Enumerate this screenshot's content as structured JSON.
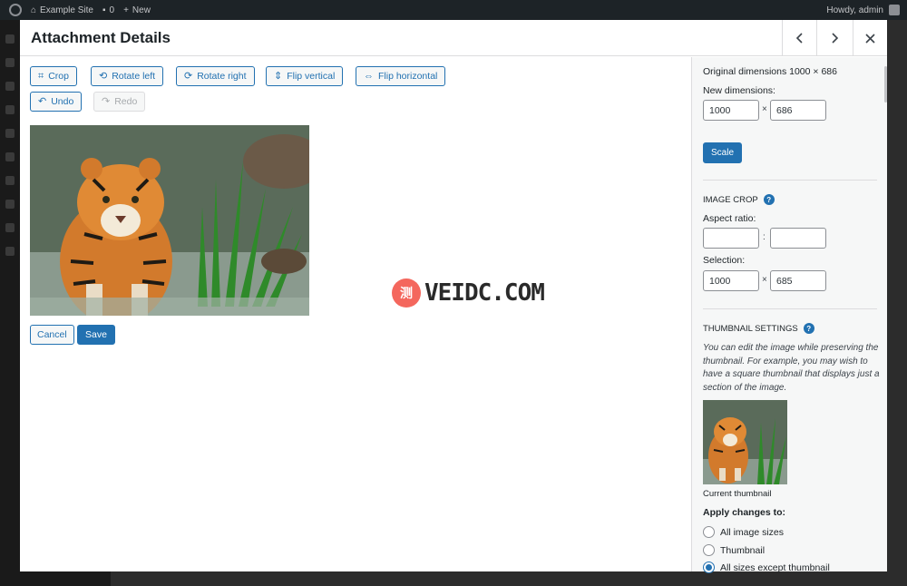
{
  "admin_bar": {
    "site_name": "Example Site",
    "comments_count": "0",
    "new_label": "New",
    "howdy": "Howdy, admin"
  },
  "modal": {
    "title": "Attachment Details",
    "prev_icon": "chevron-left-icon",
    "next_icon": "chevron-right-icon",
    "close_icon": "close-icon"
  },
  "toolbar": {
    "crop": "Crop",
    "rotate_left": "Rotate left",
    "rotate_right": "Rotate right",
    "flip_vertical": "Flip vertical",
    "flip_horizontal": "Flip horizontal",
    "undo": "Undo",
    "redo": "Redo"
  },
  "actions": {
    "cancel": "Cancel",
    "save": "Save"
  },
  "watermark": {
    "logo_char": "测",
    "text": "VEIDC.COM"
  },
  "scale": {
    "original_dimensions": "Original dimensions 1000 × 686",
    "new_dimensions_label": "New dimensions:",
    "width": "1000",
    "height": "686",
    "separator": "×",
    "scale_button": "Scale"
  },
  "crop": {
    "heading": "Image Crop",
    "aspect_ratio_label": "Aspect ratio:",
    "aspect_w": "",
    "aspect_h": "",
    "aspect_separator": ":",
    "selection_label": "Selection:",
    "selection_w": "1000",
    "selection_h": "685",
    "selection_separator": "×"
  },
  "thumbnail": {
    "heading": "Thumbnail Settings",
    "description": "You can edit the image while preserving the thumbnail. For example, you may wish to have a square thumbnail that displays just a section of the image.",
    "current_label": "Current thumbnail",
    "apply_label": "Apply changes to:",
    "options": [
      "All image sizes",
      "Thumbnail",
      "All sizes except thumbnail"
    ],
    "selected_index": 2
  },
  "colors": {
    "accent": "#2271b1",
    "admin_bar": "#1d2327",
    "sidebar_bg": "#f6f7f7"
  }
}
